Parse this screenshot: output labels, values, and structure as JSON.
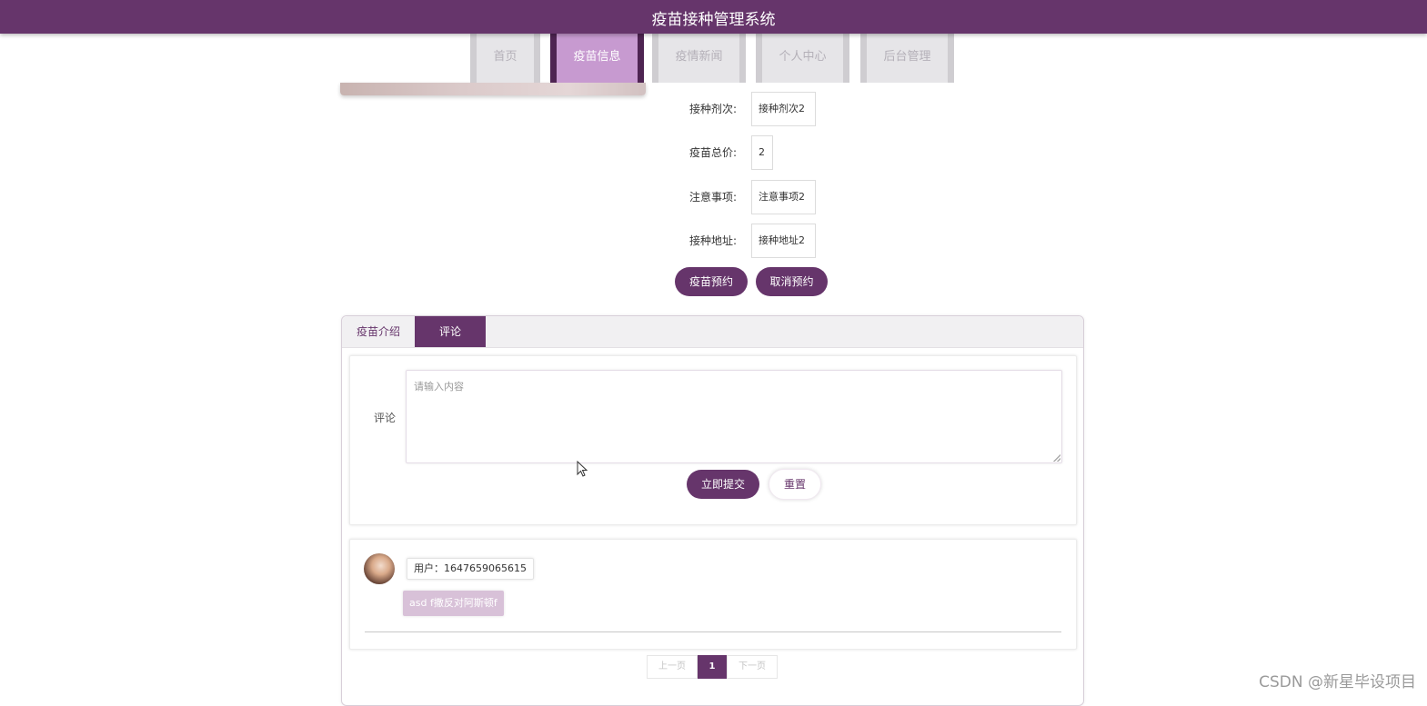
{
  "header": {
    "title": "疫苗接种管理系统"
  },
  "nav": {
    "items": [
      {
        "label": "首页"
      },
      {
        "label": "疫苗信息"
      },
      {
        "label": "疫情新闻"
      },
      {
        "label": "个人中心"
      },
      {
        "label": "后台管理"
      }
    ],
    "active_index": 1
  },
  "details": {
    "fields": [
      {
        "label": "接种剂次:",
        "value": "接种剂次2"
      },
      {
        "label": "疫苗总价:",
        "value": "2"
      },
      {
        "label": "注意事项:",
        "value": "注意事项2"
      },
      {
        "label": "接种地址:",
        "value": "接种地址2"
      }
    ],
    "book_label": "疫苗预约",
    "cancel_label": "取消预约"
  },
  "tabs": {
    "intro_label": "疫苗介绍",
    "comment_label": "评论",
    "active": "comment"
  },
  "comment_form": {
    "label": "评论",
    "placeholder": "请输入内容",
    "value": "",
    "submit_label": "立即提交",
    "reset_label": "重置"
  },
  "comments": [
    {
      "user": "用户：1647659065615",
      "content": "asd f撒反对阿斯顿f"
    }
  ],
  "pagination": {
    "prev_label": "上一页",
    "current": "1",
    "next_label": "下一页"
  },
  "watermark": "CSDN @新星毕设项目",
  "colors": {
    "brand": "#66356b",
    "active_tab": "#c79ad0",
    "bubble": "#d8c1d8"
  }
}
